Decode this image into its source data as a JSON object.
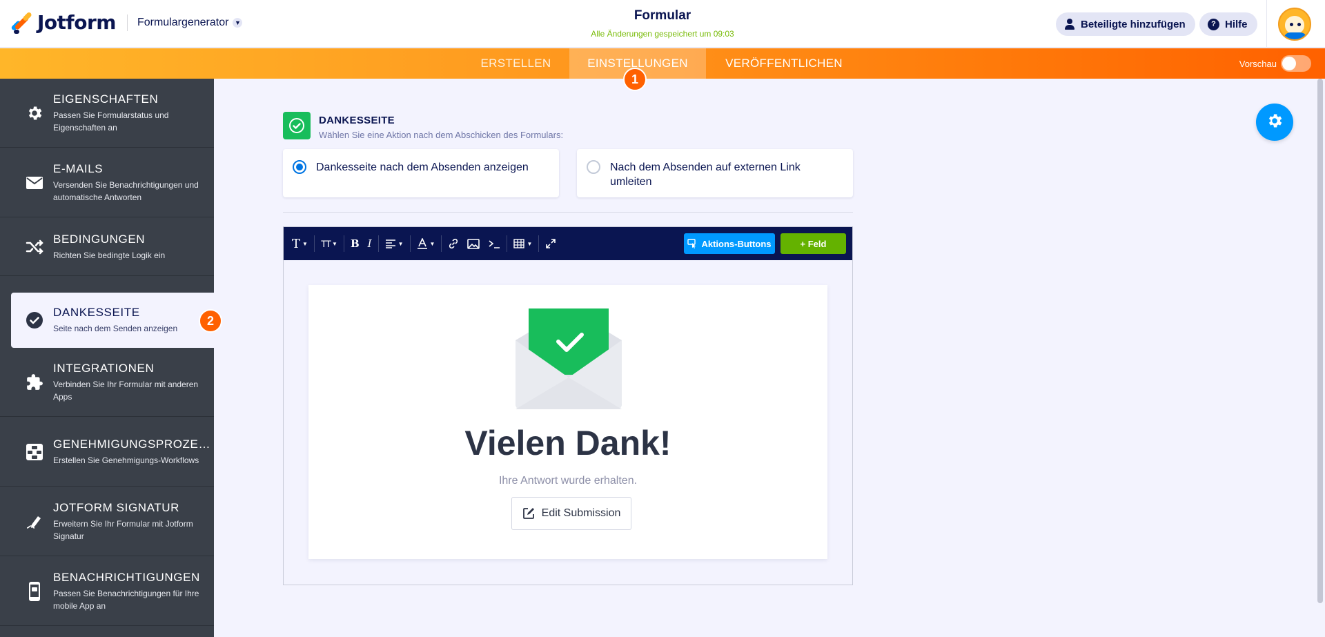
{
  "header": {
    "brand": "Jotform",
    "builder_select": "Formulargenerator",
    "form_title": "Formular",
    "saved_status": "Alle Änderungen gespeichert um 09:03",
    "share_button": "Beteiligte hinzufügen",
    "help_button": "Hilfe",
    "help_icon_glyph": "?"
  },
  "nav": {
    "tabs": [
      {
        "label": "ERSTELLEN",
        "active": false
      },
      {
        "label": "EINSTELLUNGEN",
        "active": true
      },
      {
        "label": "VERÖFFENTLICHEN",
        "active": false
      }
    ],
    "preview_label": "Vorschau",
    "preview_on": false
  },
  "badges": {
    "step1": "1",
    "step2": "2",
    "color": "#ff6100"
  },
  "sidebar": {
    "items": [
      {
        "title": "EIGENSCHAFTEN",
        "desc": "Passen Sie Formularstatus und Eigenschaften an",
        "icon": "gear-icon"
      },
      {
        "title": "E-MAILS",
        "desc": "Versenden Sie Benachrichtigungen und automatische Antworten",
        "icon": "envelope-icon"
      },
      {
        "title": "BEDINGUNGEN",
        "desc": "Richten Sie bedingte Logik ein",
        "icon": "shuffle-icon"
      },
      {
        "title": "DANKESSEITE",
        "desc": "Seite nach dem Senden anzeigen",
        "icon": "check-circle-icon",
        "active": true
      },
      {
        "title": "INTEGRATIONEN",
        "desc": "Verbinden Sie Ihr Formular mit anderen Apps",
        "icon": "puzzle-icon"
      },
      {
        "title": "GENEHMIGUNGSPROZESSE",
        "desc": "Erstellen Sie Genehmigungs-Workflows",
        "icon": "workflow-icon"
      },
      {
        "title": "JOTFORM SIGNATUR",
        "desc": "Erweitern Sie Ihr Formular mit Jotform Signatur",
        "icon": "signature-pen-icon"
      },
      {
        "title": "BENACHRICHTIGUNGEN",
        "desc": "Passen Sie Benachrichtigungen für Ihre mobile App an",
        "icon": "mobile-notification-icon"
      }
    ]
  },
  "main": {
    "section_title": "DANKESSEITE",
    "section_subtitle": "Wählen Sie eine Aktion nach dem Abschicken des Formulars:",
    "options": [
      {
        "label": "Dankesseite nach dem Absenden anzeigen",
        "selected": true
      },
      {
        "label": "Nach dem Absenden auf externen Link umleiten",
        "selected": false
      }
    ]
  },
  "editor": {
    "toolbar": {
      "text_style": "T",
      "font_size": "TT",
      "bold": "B",
      "italic": "I",
      "actions_button": "Aktions-Buttons",
      "field_button": "+ Feld"
    },
    "content": {
      "heading": "Vielen Dank!",
      "message": "Ihre Antwort wurde erhalten.",
      "edit_button": "Edit Submission"
    }
  },
  "colors": {
    "brand_navy": "#0a1551",
    "orange_nav": "#ff6100",
    "accent_blue": "#0099ff",
    "success_green": "#18bd5b",
    "field_green": "#64b200",
    "sidebar_bg": "#3a4049"
  }
}
